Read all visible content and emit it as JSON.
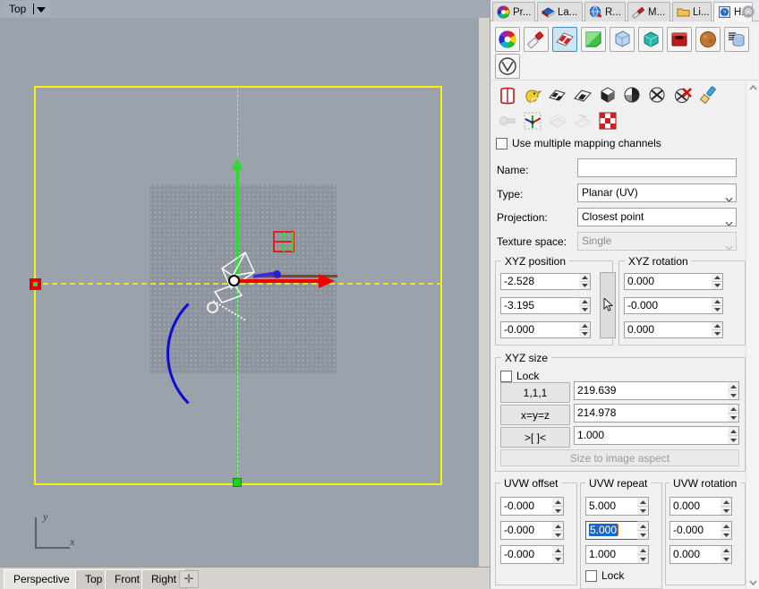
{
  "viewport": {
    "label": "Top",
    "dropdown_icon": "caret-down-icon",
    "axis_x_label": "x",
    "axis_y_label": "y",
    "tabs": [
      {
        "label": "Perspective",
        "active": false
      },
      {
        "label": "Top",
        "active": true
      },
      {
        "label": "Front",
        "active": false
      },
      {
        "label": "Right",
        "active": false
      }
    ],
    "add_tab_label": "✛",
    "colors": {
      "background": "#9aa2ac",
      "plane": "#8d949e",
      "bounds": "#f2f20a",
      "axis_x": "#f20000",
      "axis_y": "#2ddb2d",
      "axis_z": "#3b2fd6",
      "arc": "#0b0bd4"
    }
  },
  "panel": {
    "tabs": [
      {
        "label": "Pr...",
        "icon": "color-wheel-icon",
        "active": false
      },
      {
        "label": "La...",
        "icon": "layers-icon",
        "active": false
      },
      {
        "label": "R...",
        "icon": "render-globe-icon",
        "active": false
      },
      {
        "label": "M...",
        "icon": "material-brush-icon",
        "active": false
      },
      {
        "label": "Li...",
        "icon": "folder-library-icon",
        "active": false
      },
      {
        "label": "H...",
        "icon": "help-icon",
        "active": true
      }
    ],
    "gear_icon": "gear-icon",
    "material_buttons": [
      {
        "name": "color-wheel-icon",
        "selected": false
      },
      {
        "name": "paint-tube-icon",
        "selected": false
      },
      {
        "name": "checker-texture-icon",
        "selected": true
      },
      {
        "name": "green-plane-icon",
        "selected": false
      },
      {
        "name": "glass-cube-icon",
        "selected": false
      },
      {
        "name": "teal-cube-icon",
        "selected": false
      },
      {
        "name": "red-box-icon",
        "selected": false
      },
      {
        "name": "brown-sphere-icon",
        "selected": false
      },
      {
        "name": "cylinder-stack-icon",
        "selected": false
      },
      {
        "name": "vray-icon",
        "selected": false
      }
    ],
    "op_buttons_row1": [
      "add-material-icon",
      "duck-add-icon",
      "checker-flag-add-icon",
      "checker-plane-add-icon",
      "checker-cube-add-icon",
      "checker-sphere-add-icon",
      "checker-mesh-add-icon",
      "checker-delete-icon",
      "paintbrush-icon"
    ],
    "op_buttons_row2": [
      "link-disabled-icon",
      "axis-gizmo-icon",
      "box-unwrap-disabled-icon",
      "plane-unwrap-disabled-icon",
      "red-checker-icon"
    ],
    "multi_channel": {
      "label": "Use multiple mapping channels",
      "checked": false
    },
    "fields": {
      "name_label": "Name:",
      "name_value": "",
      "type_label": "Type:",
      "type_value": "Planar (UV)",
      "projection_label": "Projection:",
      "projection_value": "Closest point",
      "texture_space_label": "Texture space:",
      "texture_space_value": "Single",
      "texture_space_disabled": true
    },
    "xyz_position": {
      "title": "XYZ position",
      "values": [
        "-2.528",
        "-3.195",
        "-0.000"
      ]
    },
    "xyz_rotation": {
      "title": "XYZ rotation",
      "values": [
        "0.000",
        "-0.000",
        "0.000"
      ]
    },
    "drag_handle_icon": "drag-cursor-icon",
    "xyz_size": {
      "title": "XYZ size",
      "lock_label": "Lock",
      "lock_checked": false,
      "buttons": [
        "1,1,1",
        "x=y=z",
        ">[ ]<"
      ],
      "values": [
        "219.639",
        "214.978",
        "1.000"
      ],
      "aspect_button": "Size to image aspect",
      "aspect_disabled": true
    },
    "uvw_offset": {
      "title": "UVW offset",
      "values": [
        "-0.000",
        "-0.000",
        "-0.000"
      ]
    },
    "uvw_repeat": {
      "title": "UVW repeat",
      "values": [
        "5.000",
        "5.000",
        "1.000"
      ],
      "selected_index": 1,
      "lock_label": "Lock",
      "lock_checked": false
    },
    "uvw_rotation": {
      "title": "UVW rotation",
      "values": [
        "0.000",
        "-0.000",
        "0.000"
      ]
    },
    "scrollbar": {
      "up_icon": "chevron-up-icon",
      "down_icon": "chevron-down-icon"
    }
  }
}
